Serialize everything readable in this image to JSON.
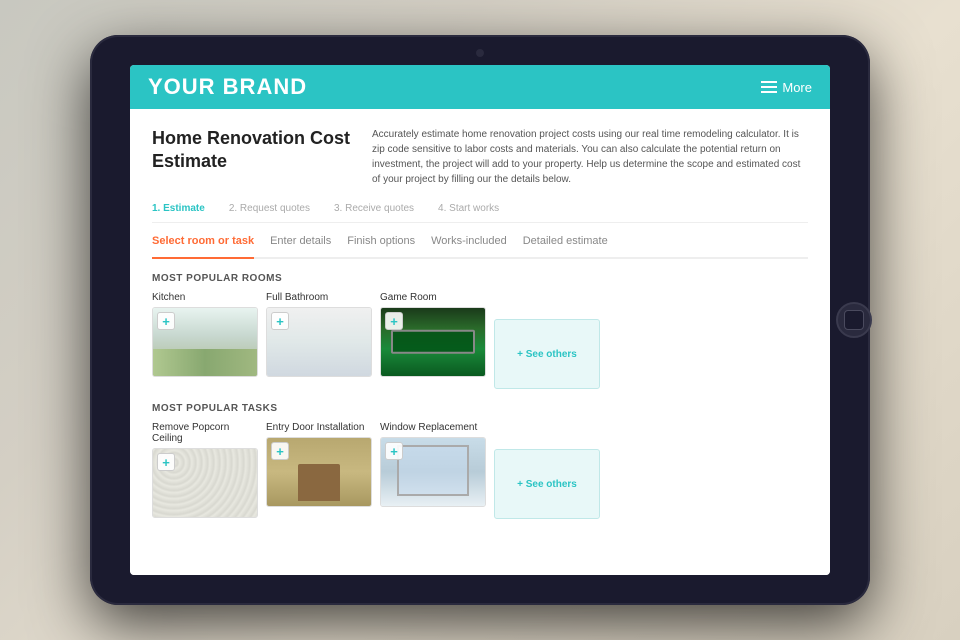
{
  "background": "#b0b0a8",
  "ipad": {
    "brand": "YOUR BRAND",
    "nav_more": "More"
  },
  "header": {
    "title": "Home Renovation Cost Estimate",
    "description": "Accurately estimate home renovation project costs using our real time remodeling calculator. It is zip code sensitive to labor costs and materials. You can also calculate the potential return on investment, the project will add to your property. Help us determine the scope and estimated cost of your project by filling our the details below."
  },
  "steps": [
    {
      "label": "1. Estimate",
      "active": true
    },
    {
      "label": "2. Request quotes",
      "active": false
    },
    {
      "label": "3. Receive quotes",
      "active": false
    },
    {
      "label": "4. Start works",
      "active": false
    }
  ],
  "tabs": [
    {
      "label": "Select room or task",
      "active": true
    },
    {
      "label": "Enter details",
      "active": false
    },
    {
      "label": "Finish options",
      "active": false
    },
    {
      "label": "Works-included",
      "active": false
    },
    {
      "label": "Detailed estimate",
      "active": false
    }
  ],
  "rooms_section": {
    "label": "MOST POPULAR ROOMS",
    "items": [
      {
        "name": "Kitchen"
      },
      {
        "name": "Full Bathroom"
      },
      {
        "name": "Game Room"
      }
    ],
    "see_others": "+ See others"
  },
  "tasks_section": {
    "label": "MOST POPULAR TASKS",
    "items": [
      {
        "name": "Remove Popcorn Ceiling"
      },
      {
        "name": "Entry Door Installation"
      },
      {
        "name": "Window Replacement"
      }
    ],
    "see_others": "+ See others"
  }
}
